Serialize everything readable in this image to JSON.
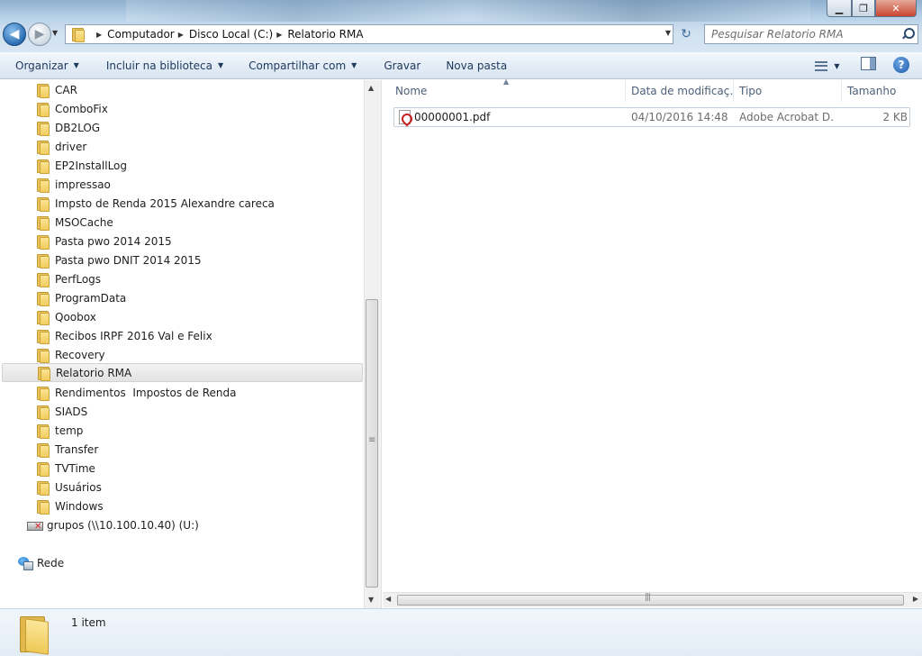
{
  "window": {
    "controls": {
      "minimize": "▁",
      "maximize": "❐",
      "close": "✕"
    }
  },
  "address": {
    "back_glyph": "◀",
    "forward_glyph": "▶",
    "crumb_separator": "▶",
    "breadcrumbs": [
      "Computador",
      "Disco Local (C:)",
      "Relatorio RMA"
    ],
    "refresh_glyph": "↻"
  },
  "search": {
    "placeholder": "Pesquisar Relatorio RMA"
  },
  "toolbar": {
    "organize": "Organizar",
    "include_library": "Incluir na biblioteca",
    "share": "Compartilhar com",
    "burn": "Gravar",
    "new_folder": "Nova pasta",
    "help_glyph": "?"
  },
  "nav_pane": {
    "folders": [
      "CAR",
      "ComboFix",
      "DB2LOG",
      "driver",
      "EP2InstallLog",
      "impressao",
      "Impsto de Renda 2015 Alexandre careca",
      "MSOCache",
      "Pasta pwo 2014 2015",
      "Pasta pwo DNIT 2014 2015",
      "PerfLogs",
      "ProgramData",
      "Qoobox",
      "Recibos IRPF 2016 Val e Felix",
      "Recovery",
      "Relatorio RMA",
      "Rendimentos  Impostos de Renda",
      "SIADS",
      "temp",
      "Transfer",
      "TVTime",
      "Usuários",
      "Windows"
    ],
    "selected_folder": "Relatorio RMA",
    "network_drive": "grupos (\\\\10.100.10.40) (U:)",
    "network": "Rede"
  },
  "columns": {
    "name": "Nome",
    "date": "Data de modificaç…",
    "type": "Tipo",
    "size": "Tamanho"
  },
  "files": [
    {
      "name": "00000001.pdf",
      "date": "04/10/2016 14:48",
      "type": "Adobe Acrobat D…",
      "size": "2 KB"
    }
  ],
  "status": {
    "item_count": "1 item"
  },
  "icons": {
    "folder": "folder-icon",
    "pdf": "pdf-icon",
    "network_drive": "disconnected-drive-icon",
    "network": "network-icon"
  }
}
